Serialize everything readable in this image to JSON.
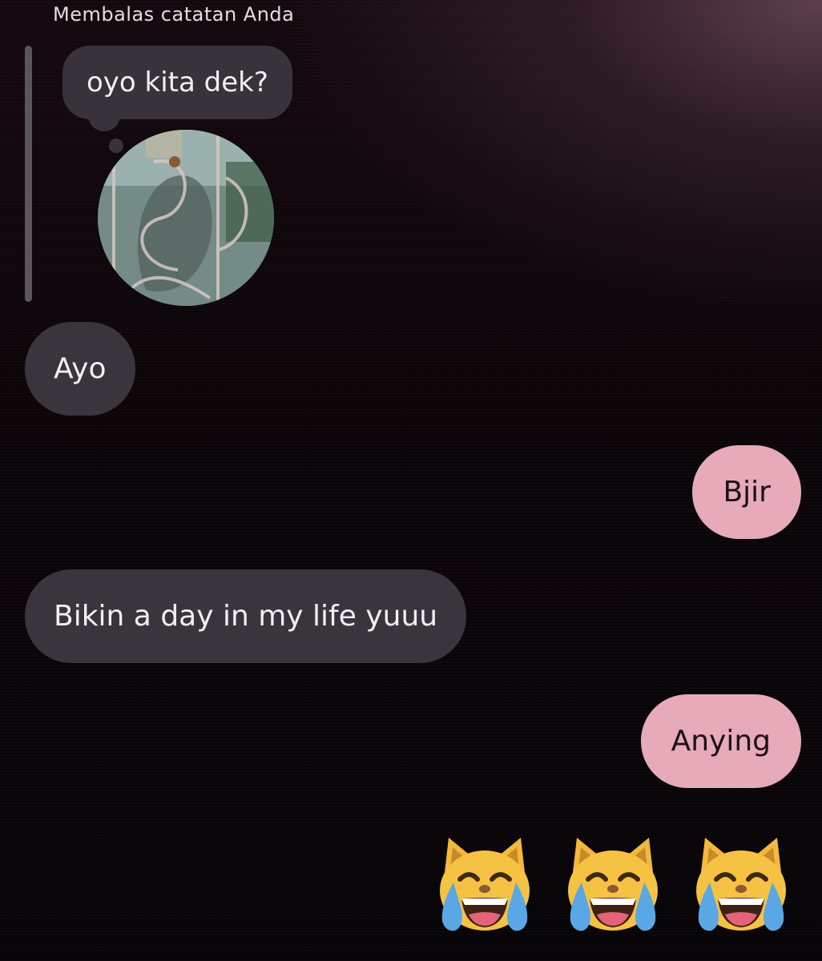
{
  "reply": {
    "header": "Membalas catatan Anda",
    "note_text": "oyo kita dek?"
  },
  "messages": [
    {
      "sender": "other",
      "text": "Ayo"
    },
    {
      "sender": "me",
      "text": "Bjir"
    },
    {
      "sender": "other",
      "text": "Bikin a day in my life yuuu"
    },
    {
      "sender": "me",
      "text": "Anying"
    }
  ],
  "emoji_reply": {
    "icon": "cat-tears-of-joy-icon",
    "count": 3
  },
  "colors": {
    "incoming_bubble": "#3a343c",
    "outgoing_bubble": "#e7aab9",
    "reply_bar": "#5a565a"
  }
}
